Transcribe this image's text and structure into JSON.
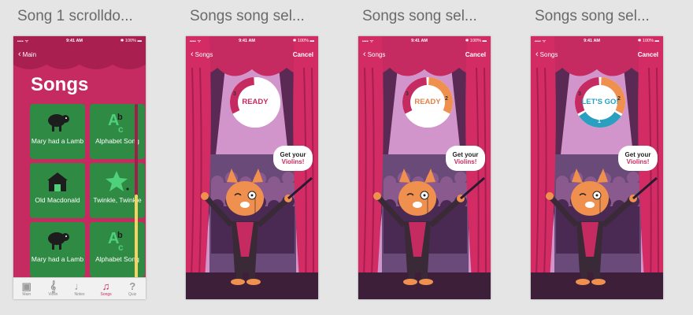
{
  "artboards": [
    {
      "title": "Song 1 scrolldo..."
    },
    {
      "title": "Songs song sel..."
    },
    {
      "title": "Songs song sel..."
    },
    {
      "title": "Songs song sel..."
    }
  ],
  "status": {
    "signal": "▪▪▪▪ ᯤ",
    "time": "9:41 AM",
    "battery": "✱ 100% ▬"
  },
  "list_screen": {
    "back_label": "Main",
    "title": "Songs",
    "tiles": [
      {
        "label": "Mary had a Lamb",
        "icon": "sheep-icon"
      },
      {
        "label": "Alphabet Song",
        "icon": "abc-icon"
      },
      {
        "label": "Old Macdonald",
        "icon": "barn-icon"
      },
      {
        "label": "Twinkle, Twinkle",
        "icon": "star-icon"
      },
      {
        "label": "Mary had a Lamb",
        "icon": "sheep-icon"
      },
      {
        "label": "Alphabet Song",
        "icon": "abc-icon"
      }
    ],
    "scroll_position": 0.5,
    "tabs": [
      {
        "label": "Main",
        "glyph": "▣"
      },
      {
        "label": "Violin",
        "glyph": "𝄞"
      },
      {
        "label": "Notes",
        "glyph": "♩"
      },
      {
        "label": "Songs",
        "glyph": "♫"
      },
      {
        "label": "Quiz",
        "glyph": "?"
      }
    ],
    "active_tab": "Songs"
  },
  "stage_screen": {
    "back_label": "Songs",
    "cancel_label": "Cancel",
    "bubble_line1": "Get your",
    "bubble_line2": "Violins!",
    "countdowns": [
      {
        "text": "READY",
        "numbers": [
          "3"
        ],
        "text_color": "#c52a60"
      },
      {
        "text": "READY",
        "numbers": [
          "3",
          "2"
        ],
        "text_color": "#e0834a"
      },
      {
        "text": "LET'S GO!",
        "numbers": [
          "3",
          "2",
          "1"
        ],
        "text_color": "#2a9fc0"
      }
    ]
  },
  "colors": {
    "brand": "#c52a60",
    "tile": "#2f8a43",
    "scroll": "#f4d35e",
    "orange": "#f0904e",
    "blue": "#2a9fc0"
  }
}
